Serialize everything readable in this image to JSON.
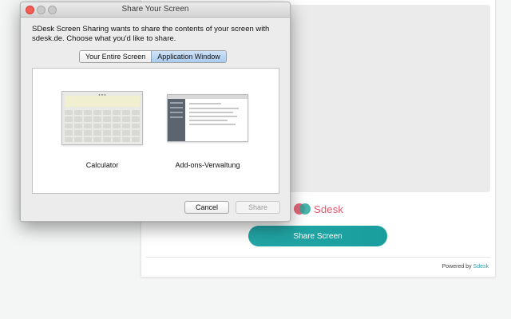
{
  "dialog": {
    "title": "Share Your Screen",
    "message": "SDesk Screen Sharing wants to share the contents of your screen with sdesk.de. Choose what you'd like to share.",
    "tabs": [
      "Your Entire Screen",
      "Application Window"
    ],
    "active_tab": "Application Window",
    "windows": [
      {
        "label": "Calculator",
        "thumb": "calculator-window"
      },
      {
        "label": "Add-ons-Verwaltung",
        "thumb": "addons-manager-window"
      }
    ],
    "cancel_label": "Cancel",
    "share_label": "Share"
  },
  "page": {
    "brand": "Sdesk",
    "share_button": "Share Screen",
    "powered_by": "Powered by",
    "powered_link": "Sdesk"
  },
  "colors": {
    "accent": "#1fa3a3",
    "brand_pink": "#e0566a",
    "close": "#f25c55",
    "active_tab": "#b7d4f2"
  }
}
